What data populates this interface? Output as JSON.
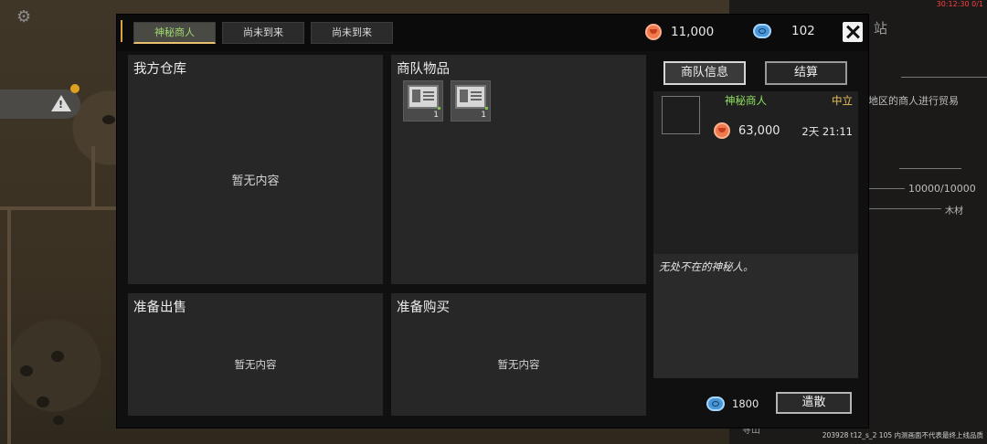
{
  "hud": {
    "top_gold": "11,000",
    "top_gems": "102",
    "top_right_debug": "30:12:30 0/1",
    "build_note": "203928 t12_s_2 105 内测画面不代表最终上线品质"
  },
  "background_panel": {
    "station_fragment": "站",
    "trade_fragment": "地区的商人进行贸易",
    "capacity": "10000/10000",
    "material": "木材",
    "search_fragment": "寻山"
  },
  "tabs": [
    {
      "label": "神秘商人",
      "active": true
    },
    {
      "label": "尚未到来",
      "active": false
    },
    {
      "label": "尚未到来",
      "active": false
    }
  ],
  "currency": {
    "gold": "11,000",
    "gems": "102"
  },
  "panels": {
    "my_warehouse": {
      "title": "我方仓库",
      "empty": "暂无内容"
    },
    "caravan_items": {
      "title": "商队物品",
      "items": [
        {
          "name": "blueprint-card",
          "count": "1"
        },
        {
          "name": "blueprint-card",
          "count": "1"
        }
      ]
    },
    "prepare_sell": {
      "title": "准备出售",
      "empty": "暂无内容"
    },
    "prepare_buy": {
      "title": "准备购买",
      "empty": "暂无内容"
    }
  },
  "side": {
    "info_button": "商队信息",
    "settle_button": "结算",
    "merchant_name": "神秘商人",
    "stance": "中立",
    "merchant_money": "63,000",
    "timer": "2天 21:11",
    "description": "无处不在的神秘人。",
    "bottom_gems": "1800",
    "dismiss_button": "遣散"
  },
  "colors": {
    "accent_green": "#8fe05f",
    "accent_gold": "#e7c25a",
    "tab_underline": "#e8c070",
    "coin_orange": "#f07a4c",
    "coin_blue": "#4a97d8"
  }
}
